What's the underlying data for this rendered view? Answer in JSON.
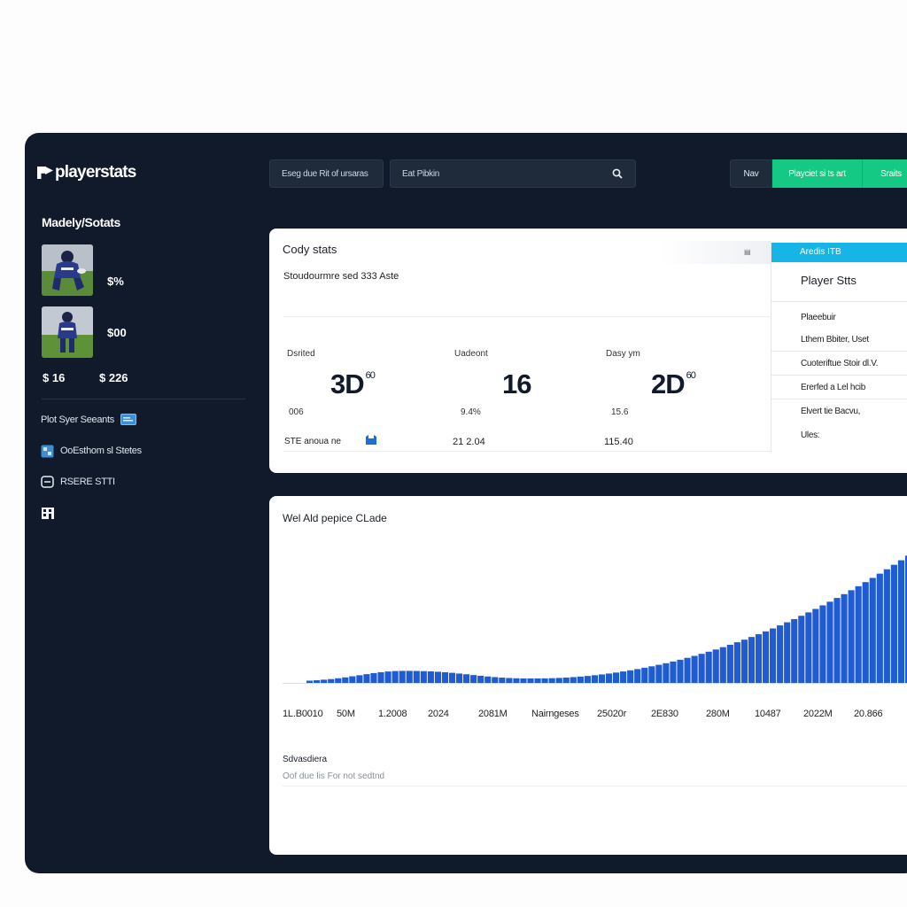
{
  "brand": {
    "logo_text": "playerstats"
  },
  "sidebar": {
    "title": "Madely/Sotats",
    "players": [
      {
        "value": "$%"
      },
      {
        "value": "$00"
      }
    ],
    "summary_left": "$ 16",
    "summary_right": "$ 226",
    "links": [
      {
        "label": "Plot Syer Seeants",
        "icon": "card-icon"
      },
      {
        "label": "OoEsthom sl Stetes",
        "icon": "grid-icon"
      },
      {
        "label": "RSERE STTI",
        "icon": "shield-icon"
      },
      {
        "label": "",
        "icon": "building-icon"
      }
    ]
  },
  "topbar": {
    "filter_label": "Eseg due Rit of ursaras",
    "search_value": "Eat Pibkin",
    "search_icon": "search-icon",
    "nav_label": "Nav",
    "primary_button": "Playciet si ts art",
    "secondary_button": "Sraits"
  },
  "stats_panel": {
    "title": "Cody stats",
    "subtitle": "Stoudourmre sed 333 Aste",
    "kpis": [
      {
        "label": "Dsrited",
        "value": "3D",
        "sup": "60",
        "sub": "006"
      },
      {
        "label": "Uadeont",
        "value": "16",
        "sup": "",
        "sub": "9.4%"
      },
      {
        "label": "Dasy ym",
        "value": "2D",
        "sup": "60",
        "sub": "15.6"
      }
    ],
    "footer_label": "STE anoua ne",
    "footer_mid": "21 2.04",
    "footer_right": "115.40"
  },
  "right_panel": {
    "header": "Aredis ITB",
    "title": "Player Stts",
    "items": [
      "Plaeebuir",
      "Lthem Bbiter, Uset",
      "Cuoteriftue Stoir dl.V.",
      "Ererfed a Lel hcib",
      "Elvert tie Bacvu,",
      "Ules:"
    ]
  },
  "chart_panel": {
    "title": "Wel Ald pepice CLade",
    "footer_title": "Sdvasdiera",
    "footer_sub": "Oof due lis For not sedtnd"
  },
  "chart_data": {
    "type": "area",
    "title": "Wel Ald pepice CLade",
    "x": [
      0,
      1,
      2,
      3,
      4,
      5,
      6,
      7,
      8,
      9,
      10,
      11,
      12,
      13,
      14,
      15,
      16,
      17,
      18,
      19,
      20,
      21,
      22,
      23,
      24,
      25,
      26,
      27,
      28,
      29,
      30,
      31,
      32,
      33,
      34,
      35,
      36,
      37,
      38,
      39,
      40,
      41,
      42,
      43,
      44,
      45,
      46,
      47,
      48,
      49,
      50,
      51,
      52,
      53,
      54,
      55,
      56,
      57,
      58,
      59,
      60,
      61,
      62,
      63,
      64,
      65,
      66,
      67,
      68,
      69,
      70,
      71,
      72,
      73,
      74,
      75,
      76,
      77,
      78,
      79,
      80,
      81,
      82,
      83,
      84,
      85,
      86,
      87,
      88,
      89,
      90,
      91,
      92,
      93,
      94,
      95,
      96,
      97,
      98,
      99,
      100,
      101,
      102,
      103,
      104,
      105,
      106,
      107,
      108,
      109,
      110,
      111,
      112,
      113,
      114,
      115,
      116,
      117,
      118,
      119,
      120,
      121,
      122,
      123,
      124,
      125,
      126,
      127,
      128,
      129,
      130,
      131,
      132,
      133,
      134,
      135,
      136,
      137,
      138,
      139,
      140
    ],
    "values": [
      2.5,
      3.0,
      3.6,
      4.3,
      5.2,
      6.2,
      7.4,
      8.6,
      9.8,
      11.0,
      12.0,
      12.8,
      13.3,
      13.5,
      13.5,
      13.4,
      13.2,
      12.9,
      12.5,
      12.0,
      11.3,
      10.5,
      9.7,
      8.8,
      8.0,
      7.2,
      6.5,
      5.9,
      5.5,
      5.2,
      5.0,
      5.0,
      5.0,
      5.1,
      5.3,
      5.6,
      6.0,
      6.5,
      7.1,
      7.8,
      8.6,
      9.5,
      10.5,
      11.6,
      12.8,
      14.1,
      15.5,
      17.0,
      18.6,
      20.3,
      22.1,
      24.0,
      26.0,
      28.1,
      30.3,
      32.6,
      35.0,
      37.5,
      40.1,
      42.8,
      45.6,
      48.5,
      51.5,
      54.6,
      57.8,
      61.1,
      64.5,
      68.0,
      71.6,
      75.3,
      79.1,
      83.0,
      87.0,
      91.1,
      95.3,
      99.6,
      104.0,
      108.5,
      113.1,
      117.8,
      122.6,
      127.5,
      132.5,
      137.6,
      142.8,
      148.1
    ],
    "tick_labels": [
      "1L.B0010",
      "50M",
      "1.2008",
      "2024",
      "2081M",
      "Nairngeses",
      "25020r",
      "2E830",
      "280M",
      "10487",
      "2022M",
      "20.866"
    ],
    "ylim": [
      0,
      160
    ],
    "grid": false,
    "color": "#1f5bd1"
  },
  "colors": {
    "app_bg": "#111a2a",
    "panel_bg": "#ffffff",
    "accent_green": "#13c983",
    "accent_cyan": "#17b4e6",
    "chart_blue": "#1f5bd1"
  }
}
